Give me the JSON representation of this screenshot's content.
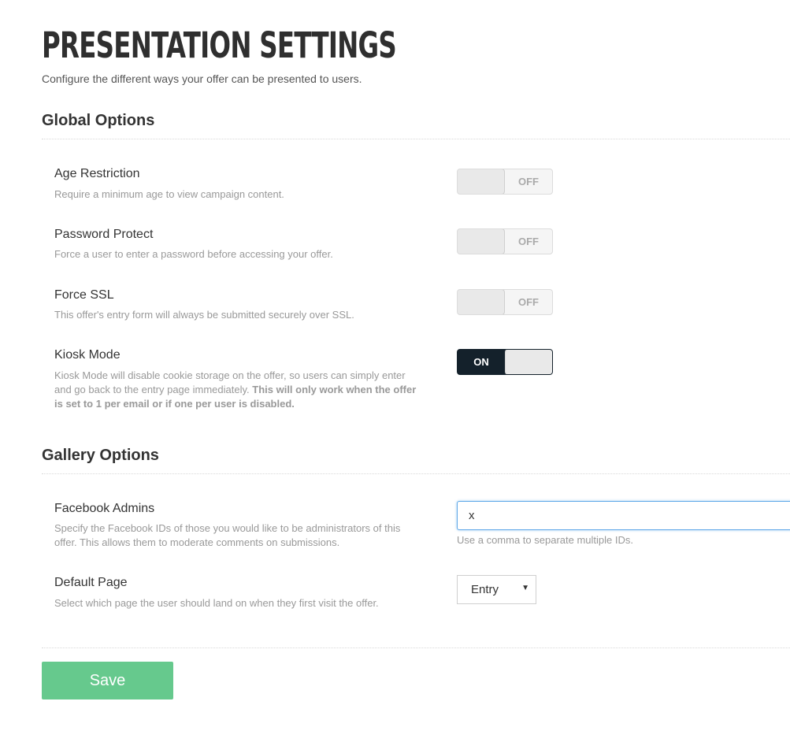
{
  "header": {
    "title": "PRESENTATION SETTINGS",
    "subtitle": "Configure the different ways your offer can be presented to users."
  },
  "global_options": {
    "title": "Global Options",
    "age_restriction": {
      "label": "Age Restriction",
      "description": "Require a minimum age to view campaign content.",
      "state": "OFF"
    },
    "password_protect": {
      "label": "Password Protect",
      "description": "Force a user to enter a password before accessing your offer.",
      "state": "OFF"
    },
    "force_ssl": {
      "label": "Force SSL",
      "description": "This offer's entry form will always be submitted securely over SSL.",
      "state": "OFF"
    },
    "kiosk_mode": {
      "label": "Kiosk Mode",
      "description": "Kiosk Mode will disable cookie storage on the offer, so users can simply enter and go back to the entry page immediately.",
      "description_bold": "This will only work when the offer is set to 1 per email or if one per user is disabled.",
      "state": "ON"
    }
  },
  "gallery_options": {
    "title": "Gallery Options",
    "facebook_admins": {
      "label": "Facebook Admins",
      "description": "Specify the Facebook IDs of those you would like to be administrators of this offer. This allows them to moderate comments on submissions.",
      "value": "x",
      "hint": "Use a comma to separate multiple IDs."
    },
    "default_page": {
      "label": "Default Page",
      "description": "Select which page the user should land on when they first visit the offer.",
      "selected": "Entry"
    }
  },
  "actions": {
    "save_label": "Save"
  },
  "colors": {
    "save_button": "#66c98d",
    "toggle_on": "#14212b",
    "input_focus": "#5fa8e8"
  }
}
